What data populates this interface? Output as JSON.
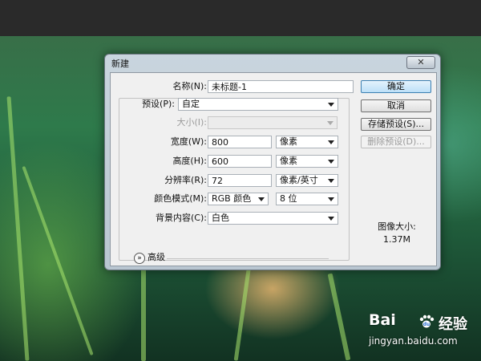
{
  "window": {
    "title": "新建",
    "close_glyph": "✕"
  },
  "form": {
    "name": {
      "label": "名称(N):",
      "value": "未标题-1"
    },
    "preset": {
      "label": "预设(P):",
      "value": "自定"
    },
    "size": {
      "label": "大小(I):",
      "value": ""
    },
    "width": {
      "label": "宽度(W):",
      "value": "800",
      "unit": "像素"
    },
    "height": {
      "label": "高度(H):",
      "value": "600",
      "unit": "像素"
    },
    "resolution": {
      "label": "分辨率(R):",
      "value": "72",
      "unit": "像素/英寸"
    },
    "color_mode": {
      "label": "颜色模式(M):",
      "value": "RGB 颜色",
      "depth": "8 位"
    },
    "background": {
      "label": "背景内容(C):",
      "value": "白色"
    },
    "advanced": {
      "label": "高级",
      "icon": "double-chevron-down-icon"
    }
  },
  "buttons": {
    "ok": "确定",
    "cancel": "取消",
    "save_preset": "存储预设(S)...",
    "delete_preset": "删除预设(D)..."
  },
  "image_info": {
    "label": "图像大小:",
    "value": "1.37M"
  },
  "watermark": {
    "logo": "Bai",
    "brand": "经验",
    "url": "jingyan.baidu.com"
  },
  "colors": {
    "primary_button": "#bde0f8",
    "dialog_frame": "#c9d5de"
  }
}
